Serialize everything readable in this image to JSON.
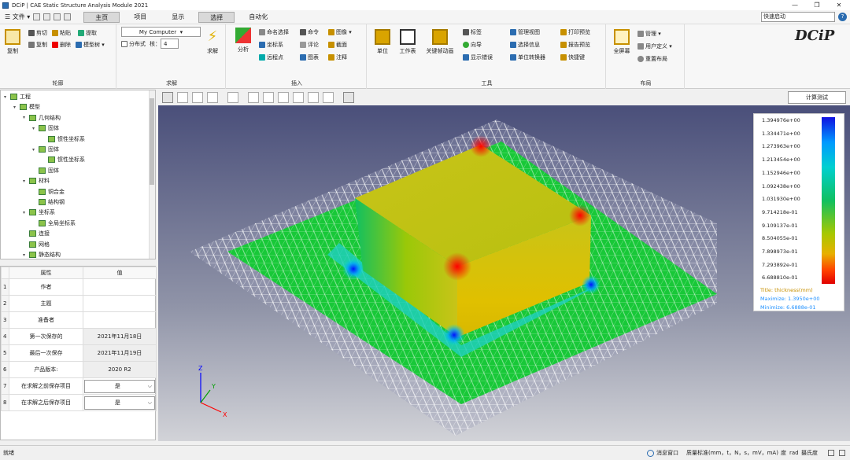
{
  "window": {
    "title": "DCiP | CAE Static Structure Analysis Module 2021",
    "minimize": "—",
    "maximize": "❐",
    "close": "✕"
  },
  "menubar": {
    "file": "文件",
    "tabs": [
      "主页",
      "项目",
      "显示",
      "选择",
      "自动化"
    ],
    "quick_search_placeholder": "快速启动",
    "help": "?"
  },
  "ribbon": {
    "outline": {
      "label": "轮廓",
      "copy": "复制",
      "cut": "剪切",
      "paste": "粘贴",
      "extract": "提取",
      "duplicate": "复制",
      "delete": "删除",
      "model_tree": "模型树"
    },
    "solve": {
      "label": "求解",
      "computer": "My Computer",
      "distributed": "分布式",
      "cores_label": "核：",
      "cores": "4",
      "solve_btn": "求解"
    },
    "insert": {
      "label": "插入",
      "analysis": "分析",
      "named_sel": "命名选择",
      "coord": "坐标系",
      "remote_point": "远程点",
      "command": "命令",
      "comment": "评论",
      "chart": "图表",
      "image": "图像",
      "section": "截面",
      "annotation": "注释"
    },
    "tools": {
      "label": "工具",
      "units": "单位",
      "worksheet": "工作表",
      "key_frame": "关键帧动画",
      "tag": "标签",
      "wizard": "向导",
      "show_error": "显示错误",
      "manage_view": "管理视图",
      "selection_info": "选择信息",
      "unit_conv": "单位转换器",
      "print_preview": "打印预览",
      "report_preview": "报告预览",
      "shortcut": "快捷键"
    },
    "layout": {
      "label": "布局",
      "fullscreen": "全屏幕",
      "manage": "管理",
      "user_def": "用户定义",
      "reset": "重置布局"
    },
    "brand": "DCiP"
  },
  "tree": [
    {
      "label": "工程",
      "indent": 0,
      "tog": "▾"
    },
    {
      "label": "模型",
      "indent": 1,
      "tog": "▾"
    },
    {
      "label": "几何结构",
      "indent": 2,
      "tog": "▾"
    },
    {
      "label": "固体",
      "indent": 3,
      "tog": "▾"
    },
    {
      "label": "惯性坐标系",
      "indent": 4,
      "tog": ""
    },
    {
      "label": "固体",
      "indent": 3,
      "tog": "▾"
    },
    {
      "label": "惯性坐标系",
      "indent": 4,
      "tog": ""
    },
    {
      "label": "固体",
      "indent": 3,
      "tog": ""
    },
    {
      "label": "材料",
      "indent": 2,
      "tog": "▾"
    },
    {
      "label": "铜合金",
      "indent": 3,
      "tog": ""
    },
    {
      "label": "结构钢",
      "indent": 3,
      "tog": ""
    },
    {
      "label": "坐标系",
      "indent": 2,
      "tog": "▾"
    },
    {
      "label": "全局坐标系",
      "indent": 3,
      "tog": ""
    },
    {
      "label": "连接",
      "indent": 2,
      "tog": ""
    },
    {
      "label": "网格",
      "indent": 2,
      "tog": ""
    },
    {
      "label": "静态结构",
      "indent": 2,
      "tog": "▾"
    }
  ],
  "props": {
    "col_prop": "属性",
    "col_val": "值",
    "rows": [
      {
        "n": "1",
        "k": "作者",
        "v": ""
      },
      {
        "n": "2",
        "k": "主题",
        "v": ""
      },
      {
        "n": "3",
        "k": "准备者",
        "v": ""
      },
      {
        "n": "4",
        "k": "第一次保存的",
        "v": "2021年11月18日"
      },
      {
        "n": "5",
        "k": "最后一次保存",
        "v": "2021年11月19日"
      },
      {
        "n": "6",
        "k": "产品版本:",
        "v": "2020 R2"
      },
      {
        "n": "7",
        "k": "在求解之前保存项目",
        "v": "是"
      },
      {
        "n": "8",
        "k": "在求解之后保存项目",
        "v": "是"
      }
    ]
  },
  "viewer": {
    "calc_test": "计算测试",
    "axis_z": "Z",
    "axis_y": "Y",
    "axis_x": "X"
  },
  "legend": {
    "values": [
      "1.394976e+00",
      "1.334471e+00",
      "1.273963e+00",
      "1.213454e+00",
      "1.152946e+00",
      "1.092438e+00",
      "1.031930e+00",
      "9.714218e-01",
      "9.109137e-01",
      "8.504055e-01",
      "7.898973e-01",
      "7.293892e-01",
      "6.688810e-01"
    ],
    "title": "Title: thickness(mm)",
    "max": "Maximize: 1.3950e+00",
    "min": "Minimize: 6.6888e-01"
  },
  "statusbar": {
    "left": "就绪",
    "messages": "消息窗口",
    "units": "质量标准(mm，t，N，s，mV，mA)",
    "angle": "度",
    "rad": "rad",
    "temp": "摄氏度"
  }
}
